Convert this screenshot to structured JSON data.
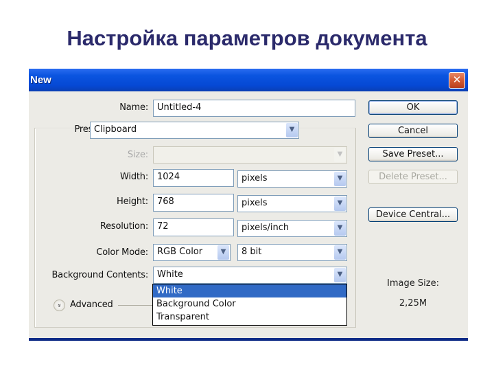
{
  "slide": {
    "title": "Настройка параметров документа"
  },
  "dialog": {
    "title": "New",
    "close_icon": "✕",
    "fields": {
      "name": {
        "label": "Name:",
        "value": "Untitled-4"
      },
      "preset": {
        "label": "Preset:",
        "value": "Clipboard"
      },
      "size": {
        "label": "Size:",
        "value": ""
      },
      "width": {
        "label": "Width:",
        "value": "1024",
        "unit": "pixels"
      },
      "height": {
        "label": "Height:",
        "value": "768",
        "unit": "pixels"
      },
      "resolution": {
        "label": "Resolution:",
        "value": "72",
        "unit": "pixels/inch"
      },
      "color_mode": {
        "label": "Color Mode:",
        "value": "RGB Color",
        "depth": "8 bit"
      },
      "background": {
        "label": "Background Contents:",
        "value": "White",
        "options": [
          "White",
          "Background Color",
          "Transparent"
        ],
        "highlighted": "White"
      }
    },
    "advanced_label": "Advanced",
    "buttons": {
      "ok": "OK",
      "cancel": "Cancel",
      "save_preset": "Save Preset...",
      "delete_preset": "Delete Preset...",
      "device_central": "Device Central..."
    },
    "image_size": {
      "label": "Image Size:",
      "value": "2,25M"
    },
    "arrow_icon": "▼",
    "advanced_icon": "»"
  }
}
